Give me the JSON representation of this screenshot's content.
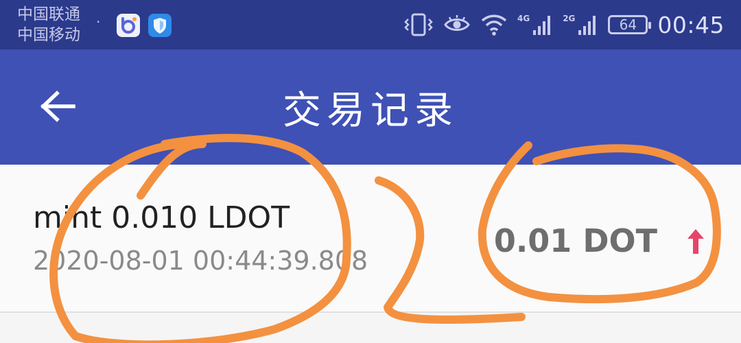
{
  "status_bar": {
    "carrier_1": "中国联通",
    "carrier_2": "中国移动",
    "separator": "·",
    "network_1": "4G",
    "network_2": "2G",
    "battery": "64",
    "time": "00:45"
  },
  "app_bar": {
    "title": "交易记录",
    "back_icon": "arrow-left-icon"
  },
  "transactions": [
    {
      "title": "mint 0.010 LDOT",
      "timestamp": "2020-08-01 00:44:39.808",
      "amount": "0.01 DOT",
      "direction_icon": "arrow-up-icon",
      "direction_color": "#e8446a"
    }
  ],
  "colors": {
    "status_bar": "#2c3a8c",
    "app_bar": "#3f51b5",
    "annotation": "#f39140"
  }
}
